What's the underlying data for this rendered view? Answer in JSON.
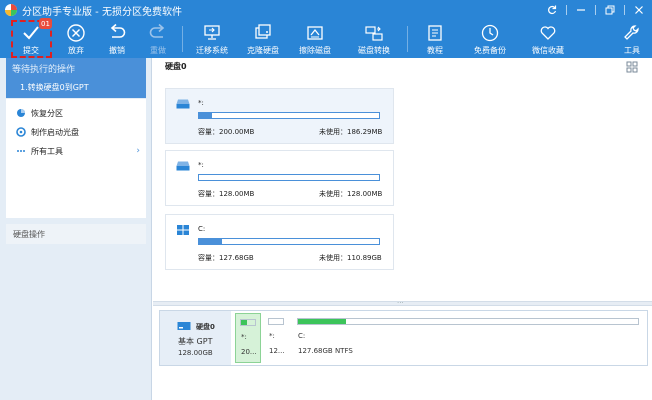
{
  "window": {
    "title": "分区助手专业版 - 无损分区免费软件",
    "controls": [
      "refresh-icon",
      "minimize-icon",
      "restore-icon",
      "close-icon"
    ]
  },
  "toolbar": {
    "submit": {
      "label": "提交",
      "icon": "check-icon",
      "badge": "01",
      "highlighted": true
    },
    "discard": {
      "label": "放弃",
      "icon": "x-circle-icon"
    },
    "undo": {
      "label": "撤销",
      "icon": "undo-icon"
    },
    "redo": {
      "label": "重做",
      "icon": "redo-icon",
      "disabled": true
    },
    "migrate": {
      "label": "迁移系统",
      "icon": "migrate-os-icon"
    },
    "clone": {
      "label": "克隆硬盘",
      "icon": "clone-disk-icon"
    },
    "wipe": {
      "label": "擦除磁盘",
      "icon": "wipe-disk-icon"
    },
    "convert": {
      "label": "磁盘转换",
      "icon": "disk-convert-icon"
    },
    "tutorial": {
      "label": "教程",
      "icon": "book-icon"
    },
    "backup": {
      "label": "免费备份",
      "icon": "backup-icon"
    },
    "wechat": {
      "label": "微信收藏",
      "icon": "heart-icon"
    },
    "tools": {
      "label": "工具",
      "icon": "wrench-icon"
    }
  },
  "sidebar": {
    "pending": {
      "title": "等待执行的操作",
      "ops": [
        "1.转换硬盘0到GPT"
      ]
    },
    "menu": [
      {
        "label": "恢复分区",
        "icon": "pie-icon"
      },
      {
        "label": "制作启动光盘",
        "icon": "gear-disc-icon"
      },
      {
        "label": "所有工具",
        "icon": "dots-icon",
        "arrow": "›"
      }
    ],
    "section": "硬盘操作"
  },
  "main": {
    "header": "硬盘0",
    "view_icon": "grid-view-icon",
    "cards": [
      {
        "name": "*:",
        "icon": "drive-icon",
        "cap_label": "容量：200.00MB",
        "free_label": "未使用：186.29MB",
        "used_fraction": 0.07,
        "selected": true
      },
      {
        "name": "*:",
        "icon": "drive-icon",
        "cap_label": "容量：128.00MB",
        "free_label": "未使用：128.00MB",
        "used_fraction": 0.0,
        "selected": false
      },
      {
        "name": "C:",
        "icon": "windows-icon",
        "cap_label": "容量：127.68GB",
        "free_label": "未使用：110.89GB",
        "used_fraction": 0.13,
        "selected": false
      }
    ],
    "disk": {
      "name": "硬盘0",
      "type": "基本 GPT",
      "size": "128.00GB",
      "partitions": [
        {
          "label": "*:",
          "size": "20...",
          "used_fraction": 0.4,
          "selected": true
        },
        {
          "label": "*:",
          "size": "12...",
          "used_fraction": 0.0,
          "selected": false
        },
        {
          "label": "C:",
          "size": "127.68GB NTFS",
          "used_fraction": 0.14,
          "selected": false
        }
      ]
    }
  },
  "colors": {
    "accent": "#2a85d6",
    "bar": "#4a90d9",
    "used_green": "#3cc45a",
    "highlight_red": "#e02020"
  }
}
